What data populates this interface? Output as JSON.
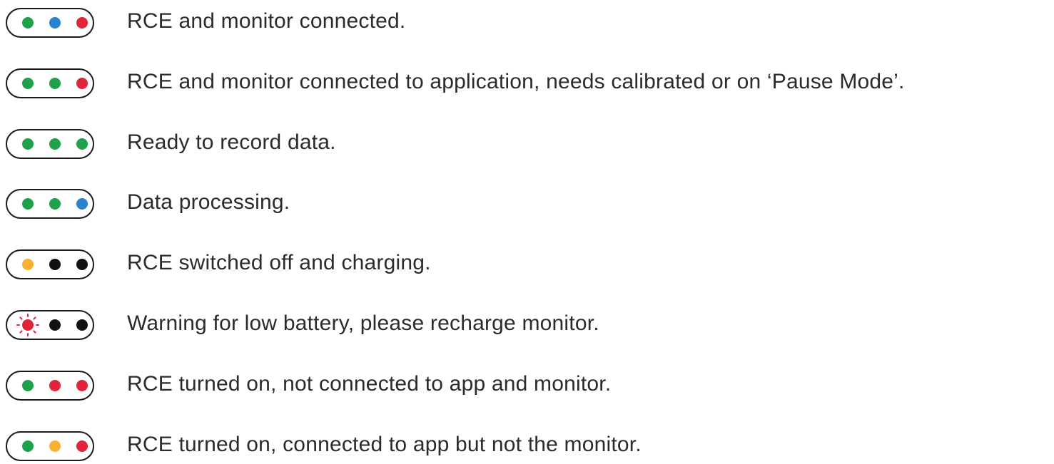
{
  "colors": {
    "green": "#1ea14a",
    "blue": "#2a82d0",
    "red": "#e0253a",
    "amber": "#fbb130",
    "black": "#111111",
    "outline": "#1a1a1a",
    "text": "#2b2b2b"
  },
  "rows": [
    {
      "leds": [
        "green",
        "blue",
        "red"
      ],
      "blink": [
        false,
        false,
        false
      ],
      "label": "RCE and monitor connected."
    },
    {
      "leds": [
        "green",
        "green",
        "red"
      ],
      "blink": [
        false,
        false,
        false
      ],
      "label": "RCE and monitor connected to application, needs calibrated or on ‘Pause Mode’."
    },
    {
      "leds": [
        "green",
        "green",
        "green"
      ],
      "blink": [
        false,
        false,
        false
      ],
      "label": "Ready to record data."
    },
    {
      "leds": [
        "green",
        "green",
        "blue"
      ],
      "blink": [
        false,
        false,
        false
      ],
      "label": "Data processing."
    },
    {
      "leds": [
        "amber",
        "black",
        "black"
      ],
      "blink": [
        false,
        false,
        false
      ],
      "label": "RCE switched off and charging."
    },
    {
      "leds": [
        "red",
        "black",
        "black"
      ],
      "blink": [
        true,
        false,
        false
      ],
      "label": "Warning for low battery, please recharge monitor."
    },
    {
      "leds": [
        "green",
        "red",
        "red"
      ],
      "blink": [
        false,
        false,
        false
      ],
      "label": "RCE turned on, not connected to app and monitor."
    },
    {
      "leds": [
        "green",
        "amber",
        "red"
      ],
      "blink": [
        false,
        false,
        false
      ],
      "label": "RCE turned on, connected to app but not the monitor."
    }
  ]
}
